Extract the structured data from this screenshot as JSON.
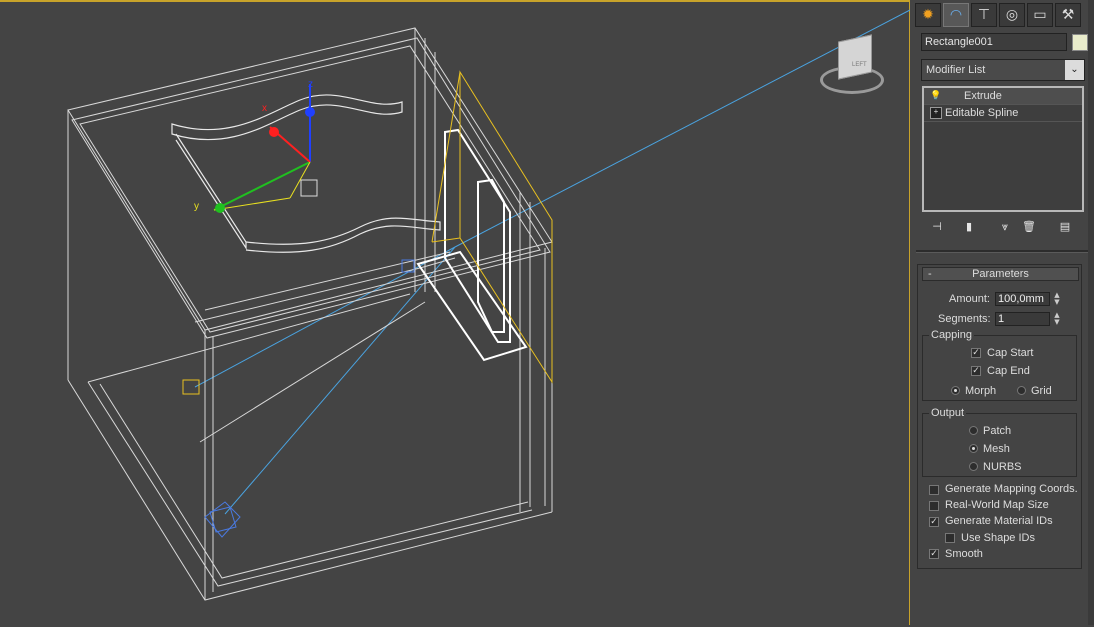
{
  "tabs": [
    {
      "name": "create-tab",
      "glyph": "✹"
    },
    {
      "name": "modify-tab",
      "glyph": "◠"
    },
    {
      "name": "hierarchy-tab",
      "glyph": "⊤"
    },
    {
      "name": "motion-tab",
      "glyph": "◎"
    },
    {
      "name": "display-tab",
      "glyph": "▭"
    },
    {
      "name": "utilities-tab",
      "glyph": "⚒"
    }
  ],
  "object": {
    "name": "Rectangle001",
    "color": "#e9eccb"
  },
  "modifier_list": {
    "label": "Modifier List"
  },
  "stack": [
    {
      "label": "Extrude",
      "icon": "lightbulb-icon"
    },
    {
      "label": "Editable Spline",
      "icon": "plus-box-icon"
    }
  ],
  "parameters": {
    "title": "Parameters",
    "collapse": "-",
    "amount_label": "Amount:",
    "amount_value": "100,0mm",
    "segments_label": "Segments:",
    "segments_value": "1",
    "capping": {
      "title": "Capping",
      "cap_start": "Cap Start",
      "cap_end": "Cap End",
      "morph": "Morph",
      "grid": "Grid"
    },
    "output": {
      "title": "Output",
      "patch": "Patch",
      "mesh": "Mesh",
      "nurbs": "NURBS"
    },
    "gen_mapping": "Generate Mapping Coords.",
    "real_world": "Real-World Map Size",
    "gen_material": "Generate Material IDs",
    "use_shape": "Use Shape IDs",
    "smooth": "Smooth"
  },
  "viewcube": {
    "face": "LEFT"
  },
  "gizmo": {
    "x": "x",
    "y": "y",
    "z": "z"
  },
  "colors": {
    "accent": "#c8a32a",
    "camera": "#4aa3e0",
    "wire": "#d8d8d8"
  }
}
